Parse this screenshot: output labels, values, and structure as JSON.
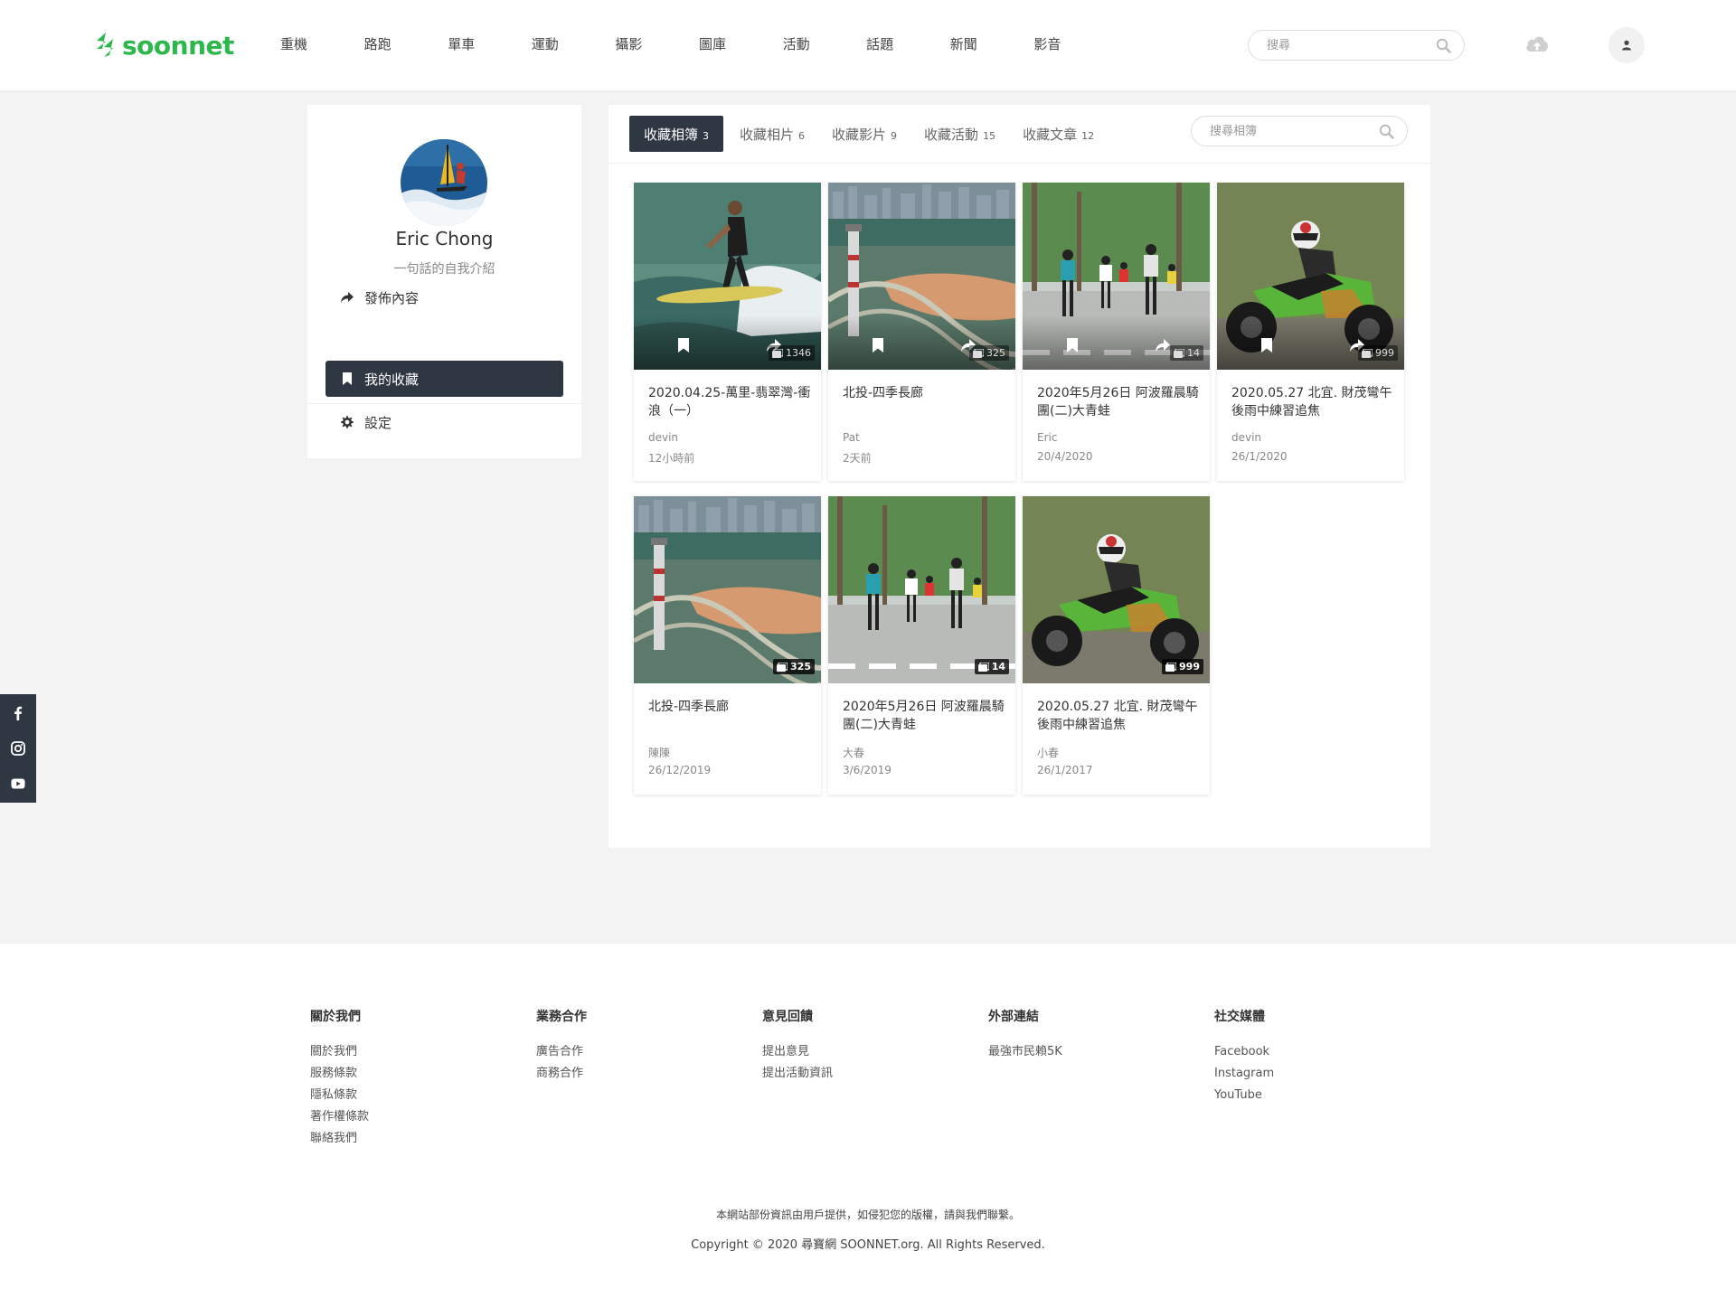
{
  "brand": {
    "name": "soonnet",
    "color": "#2db84d"
  },
  "nav": [
    "重機",
    "路跑",
    "單車",
    "運動",
    "攝影",
    "圖庫",
    "活動",
    "話題",
    "新聞",
    "影音"
  ],
  "header": {
    "search_placeholder": "搜尋",
    "icons": [
      "search-icon",
      "cloud-upload-icon",
      "user-icon"
    ]
  },
  "profile": {
    "name": "Eric Chong",
    "bio": "一句話的自我介紹",
    "menu": [
      {
        "label": "發佈內容",
        "icon": "share-icon"
      },
      {
        "label": "我的收藏",
        "icon": "bookmark-icon",
        "active": true
      },
      {
        "label": "設定",
        "icon": "gear-icon"
      }
    ]
  },
  "tabs": [
    {
      "label": "收藏相簿",
      "count": "3",
      "active": true
    },
    {
      "label": "收藏相片",
      "count": "6"
    },
    {
      "label": "收藏影片",
      "count": "9"
    },
    {
      "label": "收藏活動",
      "count": "15"
    },
    {
      "label": "收藏文章",
      "count": "12"
    }
  ],
  "album_search_placeholder": "搜尋相簿",
  "cards": [
    {
      "title": "2020.04.25-萬里-翡翠灣-衝浪（一）",
      "author": "devin",
      "date": "12小時前",
      "count": "1346",
      "image": "surfer"
    },
    {
      "title": "北投-四季長廊",
      "author": "Pat",
      "date": "2天前",
      "count": "325",
      "image": "city"
    },
    {
      "title": "2020年5月26日 阿波羅晨騎團(二)大青蛙",
      "author": "Eric",
      "date": "20/4/2020",
      "count": "14",
      "image": "cyclists"
    },
    {
      "title": "2020.05.27 北宜. 財茂彎午後雨中練習追焦",
      "author": "devin",
      "date": "26/1/2020",
      "count": "999",
      "image": "motorbike"
    },
    {
      "title": "北投-四季長廊",
      "author": "陳陳",
      "date": "26/12/2019",
      "count": "325",
      "image": "city"
    },
    {
      "title": "2020年5月26日 阿波羅晨騎團(二)大青蛙",
      "author": "大春",
      "date": "3/6/2019",
      "count": "14",
      "image": "cyclists"
    },
    {
      "title": "2020.05.27 北宜. 財茂彎午後雨中練習追焦",
      "author": "小春",
      "date": "26/1/2017",
      "count": "999",
      "image": "motorbike"
    }
  ],
  "social_bar": [
    "facebook-icon",
    "instagram-icon",
    "youtube-icon"
  ],
  "footer": {
    "columns": [
      {
        "title": "關於我們",
        "links": [
          "關於我們",
          "服務條款",
          "隱私條款",
          "著作權條款",
          "聯絡我們"
        ]
      },
      {
        "title": "業務合作",
        "links": [
          "廣告合作",
          "商務合作"
        ]
      },
      {
        "title": "意見回饋",
        "links": [
          "提出意見",
          "提出活動資訊"
        ]
      },
      {
        "title": "外部連結",
        "links": [
          "最強市民賴5K"
        ]
      },
      {
        "title": "社交媒體",
        "links": [
          "Facebook",
          "Instagram",
          "YouTube"
        ]
      }
    ],
    "notice": "本網站部份資訊由用戶提供，如侵犯您的版權，請與我們聯繫。",
    "copyright": "Copyright © 2020 尋寶網 SOONNET.org. All Rights Reserved."
  }
}
